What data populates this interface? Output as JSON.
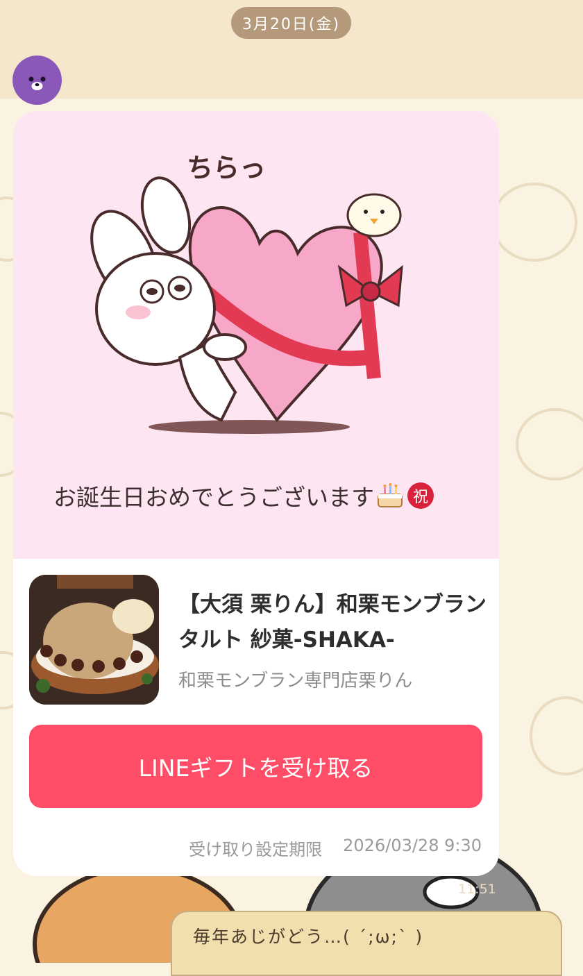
{
  "chat": {
    "date_label": "3月20日(金)",
    "colors": {
      "background": "#fbf3e1",
      "date_pill": "#b49a7a",
      "avatar": "#8a58b9",
      "button": "#ff4d68",
      "card_top": "#fde6f2"
    }
  },
  "gift_card": {
    "sticker_text": "ちらっ",
    "message": "お誕生日おめでとうございます",
    "message_emojis": [
      "birthday-cake-icon",
      "iwai-icon"
    ],
    "iwai_glyph": "祝",
    "product_title": "【大須 栗りん】和栗モンブランタルト 紗菓-SHAKA-",
    "shop_name": "和栗モンブラン専門店栗りん",
    "button_label": "LINEギフトを受け取る",
    "deadline_label": "受け取り設定期限",
    "deadline_value": "2026/03/28 9:30"
  },
  "timestamp": "11:51",
  "reply": {
    "text": "毎年あじがどう…( ´;ω;` )"
  }
}
